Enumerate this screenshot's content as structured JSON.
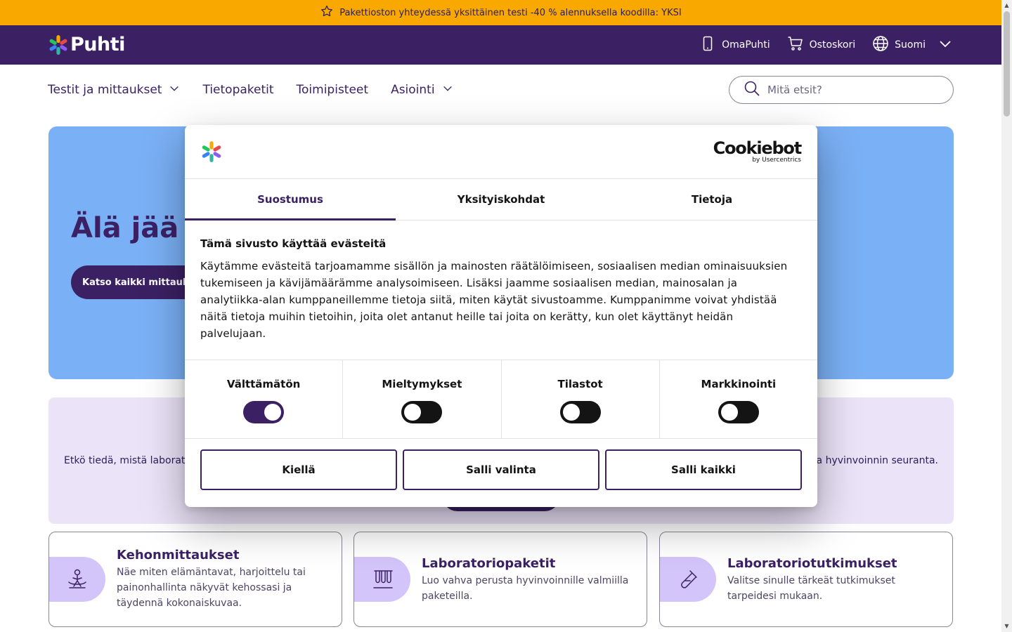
{
  "promo": {
    "text": "Pakettioston yhteydessä yksittäinen testi -40 % alennuksella koodilla: YKSI",
    "icon": "star-icon"
  },
  "header": {
    "logo_text": "Puhti",
    "links": [
      {
        "label": "OmaPuhti",
        "icon": "phone-icon"
      },
      {
        "label": "Ostoskori",
        "icon": "cart-icon"
      },
      {
        "label": "Suomi",
        "icon": "globe-icon"
      }
    ]
  },
  "nav": {
    "items": [
      {
        "label": "Testit ja mittaukset",
        "has_dropdown": true
      },
      {
        "label": "Tietopaketit",
        "has_dropdown": false
      },
      {
        "label": "Toimipisteet",
        "has_dropdown": false
      },
      {
        "label": "Asiointi",
        "has_dropdown": true
      }
    ],
    "search_placeholder": "Mitä etsit?"
  },
  "hero": {
    "title": "Älä jää ra",
    "button": "Katso kaikki mittaukset"
  },
  "band": {
    "text_left": "Etkö tiedä, mistä laborat",
    "text_right": "a hyvinvoinnin seuranta."
  },
  "cards": [
    {
      "title": "Kehonmittaukset",
      "desc": "Näe miten elämäntavat, harjoittelu tai painonhallinta näkyvät kehossasi ja täydennä kokonaiskuvaa.",
      "icon": "body-measure-icon"
    },
    {
      "title": "Laboratoriopaketit",
      "desc": "Luo vahva perusta hyvinvoinnille valmiilla paketeilla.",
      "icon": "test-tubes-icon"
    },
    {
      "title": "Laboratoriotutkimukset",
      "desc": "Valitse sinulle tärkeät tutkimukset tarpeidesi mukaan.",
      "icon": "test-tube-icon"
    }
  ],
  "cookie": {
    "brand": "Cookiebot",
    "brand_sub": "by Usercentrics",
    "tabs": [
      "Suostumus",
      "Yksityiskohdat",
      "Tietoja"
    ],
    "active_tab": "Suostumus",
    "heading": "Tämä sivusto käyttää evästeitä",
    "body": "Käytämme evästeitä tarjoamamme sisällön ja mainosten räätälöimiseen, sosiaalisen median ominaisuuksien tukemiseen ja kävijämäärämme analysoimiseen. Lisäksi jaamme sosiaalisen median, mainosalan ja analytiikka-alan kumppaneillemme tietoja siitä, miten käytät sivustoamme. Kumppanimme voivat yhdistää näitä tietoja muihin tietoihin, joita olet antanut heille tai joita on kerätty, kun olet käyttänyt heidän palvelujaan.",
    "toggles": [
      {
        "label": "Välttämätön",
        "on": true
      },
      {
        "label": "Mieltymykset",
        "on": false
      },
      {
        "label": "Tilastot",
        "on": false
      },
      {
        "label": "Markkinointi",
        "on": false
      }
    ],
    "buttons": {
      "deny": "Kiellä",
      "allow_selection": "Salli valinta",
      "allow_all": "Salli kaikki"
    }
  },
  "colors": {
    "brand_purple": "#3b2164",
    "promo_yellow": "#f9a800",
    "hero_blue": "#7ab0f5",
    "lavender": "#ebe3f8",
    "icon_lilac": "#d3c4fa"
  }
}
